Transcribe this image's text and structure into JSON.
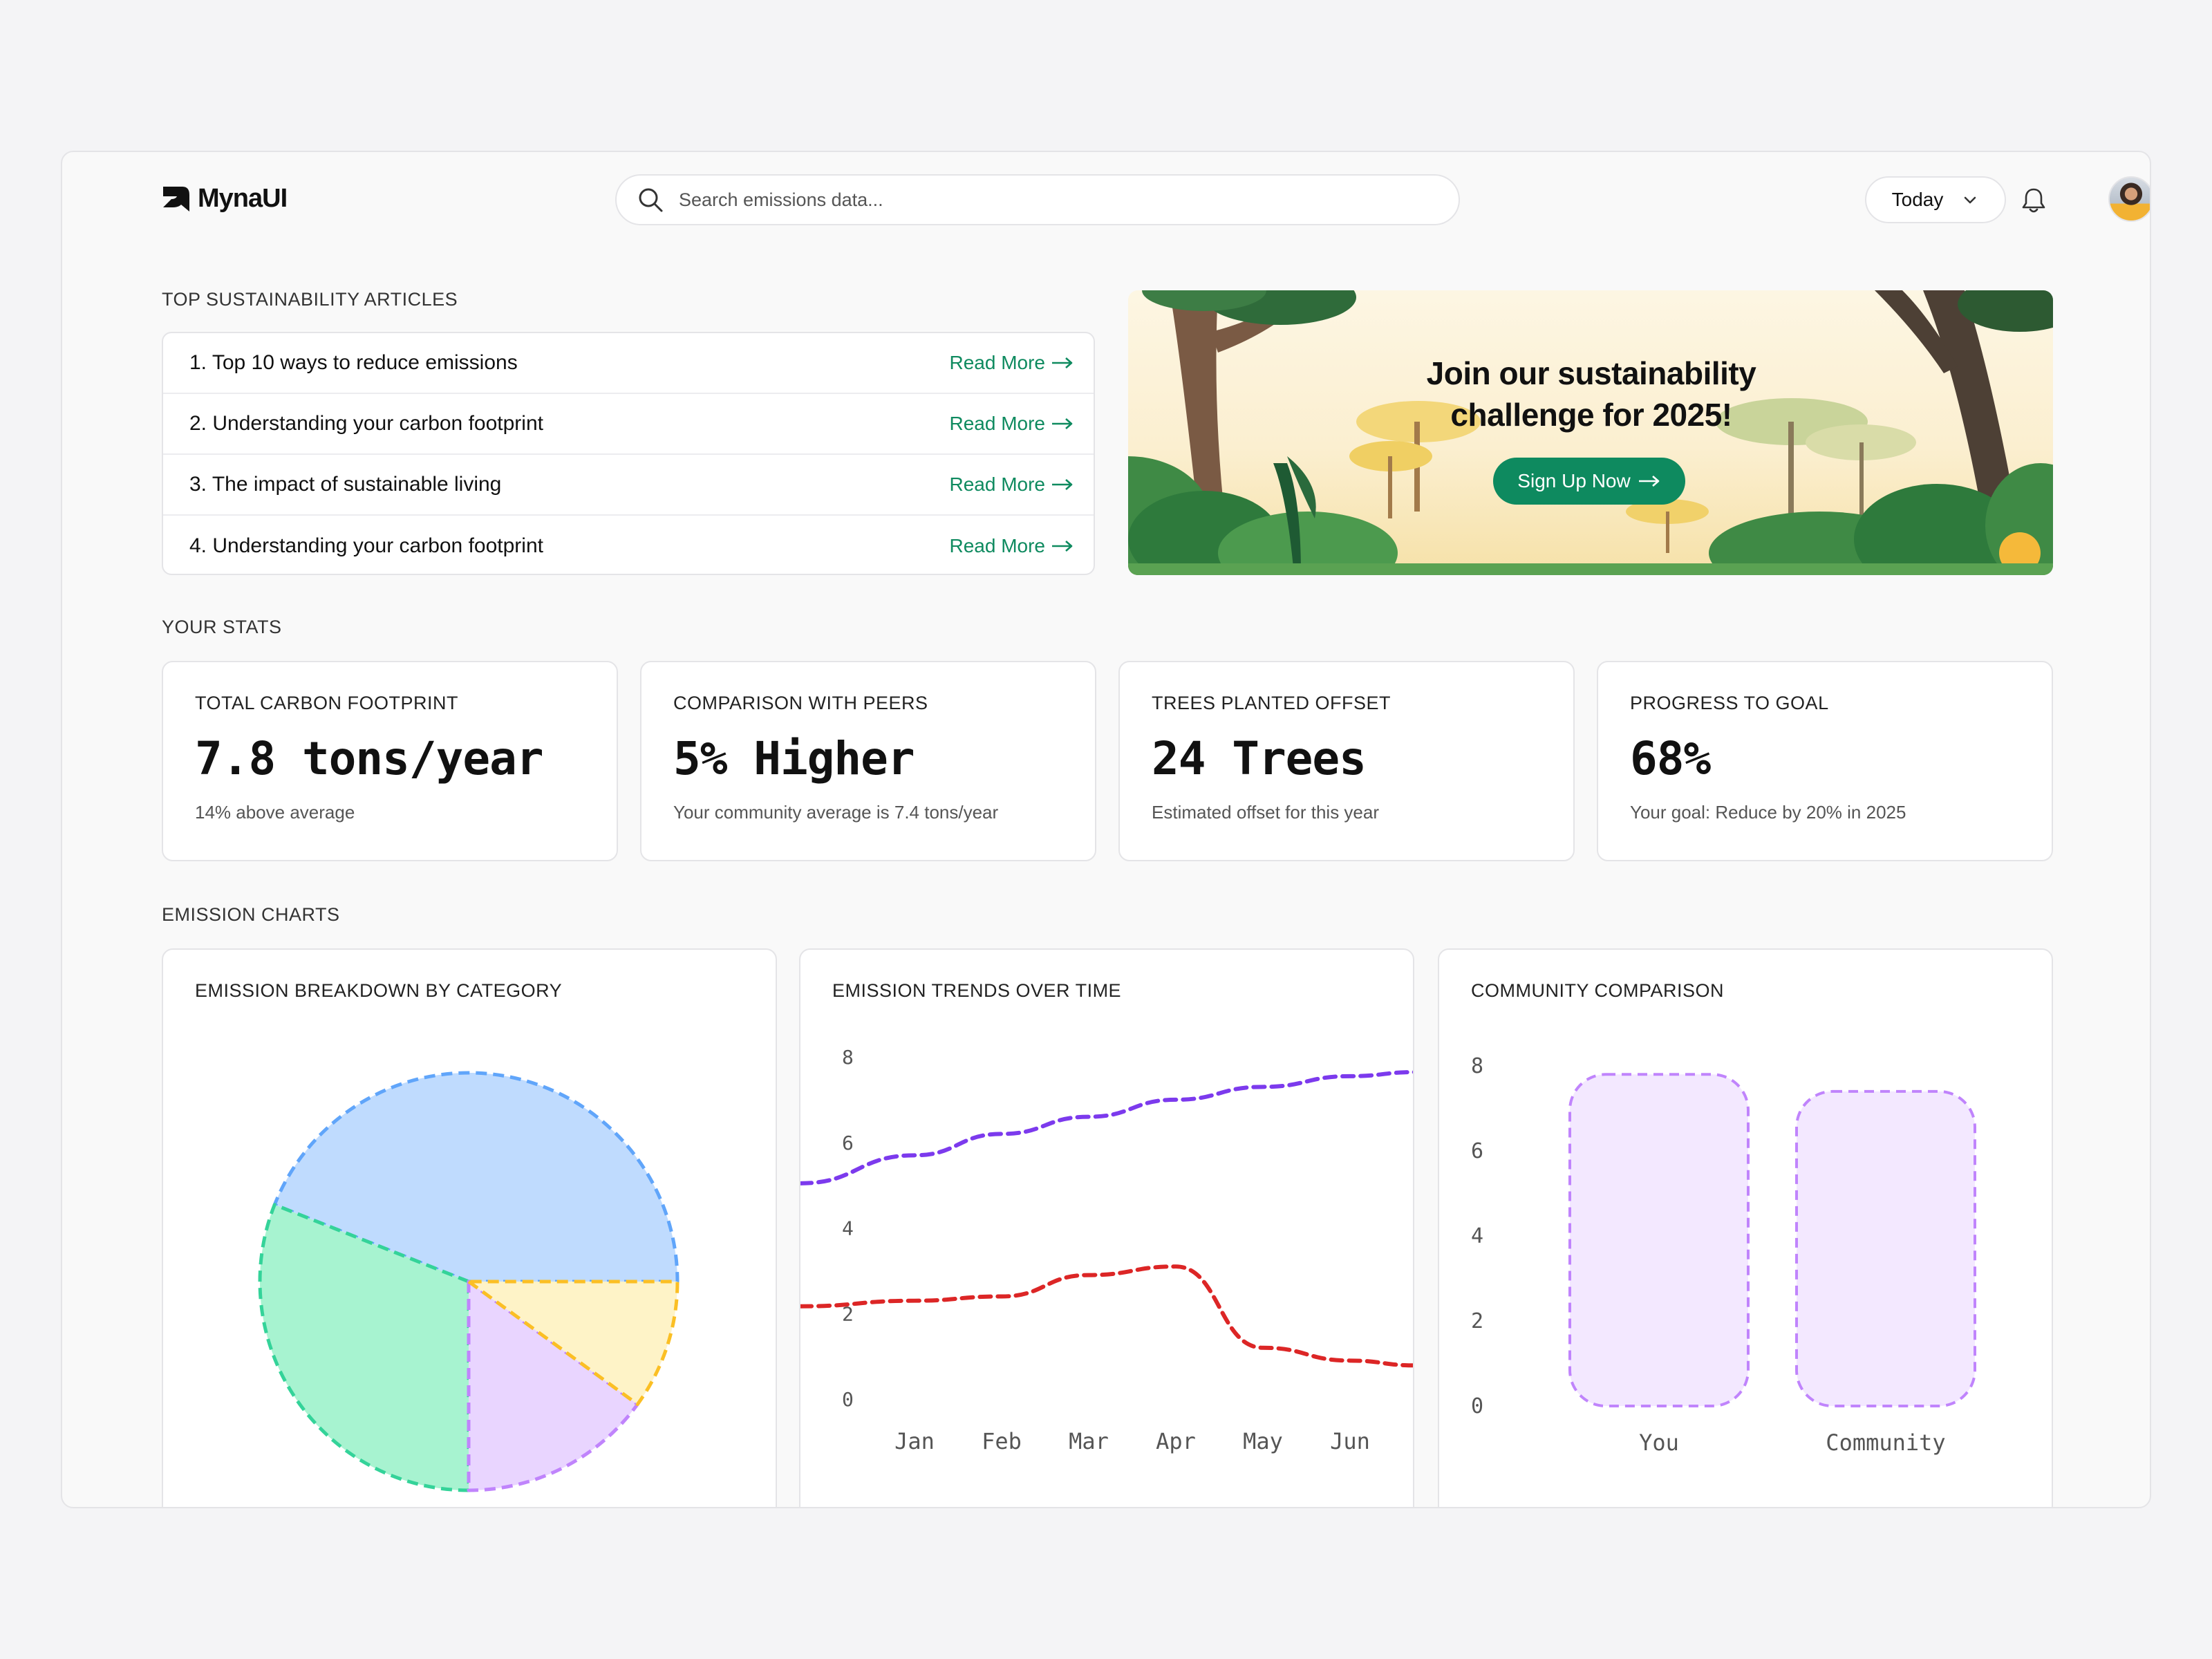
{
  "app": {
    "logo_text": "MynaUI"
  },
  "search": {
    "placeholder": "Search emissions data..."
  },
  "header": {
    "date_filter": "Today"
  },
  "articles": {
    "section_label": "TOP SUSTAINABILITY ARTICLES",
    "read_more_label": "Read More",
    "items": [
      {
        "title": "1. Top 10 ways to reduce emissions"
      },
      {
        "title": "2. Understanding your carbon footprint"
      },
      {
        "title": "3. The impact of sustainable living"
      },
      {
        "title": "4. Understanding your carbon footprint"
      }
    ]
  },
  "banner": {
    "line1": "Join our sustainability",
    "line2": "challenge for 2025!",
    "cta": "Sign Up Now"
  },
  "stats": {
    "section_label": "YOUR STATS",
    "cards": [
      {
        "label": "TOTAL CARBON FOOTPRINT",
        "value": "7.8 tons/year",
        "sub": "14% above average"
      },
      {
        "label": "COMPARISON WITH PEERS",
        "value": "5% Higher",
        "sub": "Your community average is 7.4 tons/year"
      },
      {
        "label": "TREES PLANTED OFFSET",
        "value": "24 Trees",
        "sub": "Estimated offset for this year"
      },
      {
        "label": "PROGRESS TO GOAL",
        "value": "68%",
        "sub": "Your goal: Reduce by 20% in 2025"
      }
    ]
  },
  "charts_section_label": "EMISSION CHARTS",
  "colors": {
    "accent": "#0e8a5f",
    "pie_blue": "#bfdbfe",
    "pie_blue_stroke": "#60a5fa",
    "pie_green": "#a7f3d0",
    "pie_green_stroke": "#34d399",
    "pie_purple": "#e9d5ff",
    "pie_purple_stroke": "#c084fc",
    "pie_yellow": "#fef3c7",
    "pie_yellow_stroke": "#fbbf24",
    "line_purple": "#7c3aed",
    "line_red": "#dc2626",
    "bar_fill": "#f3e8ff",
    "bar_stroke": "#c084fc"
  },
  "chart_data": [
    {
      "type": "pie",
      "title": "EMISSION BREAKDOWN BY CATEGORY",
      "slices": [
        {
          "value": 44
        },
        {
          "value": 31
        },
        {
          "value": 15
        },
        {
          "value": 10
        }
      ]
    },
    {
      "type": "line",
      "title": "EMISSION TRENDS OVER TIME",
      "x": [
        "Jan",
        "Feb",
        "Mar",
        "Apr",
        "May",
        "Jun"
      ],
      "yticks": [
        0,
        2,
        4,
        6,
        8
      ],
      "ylim": [
        0,
        8
      ],
      "series": [
        {
          "values": [
            5.7,
            6.2,
            6.6,
            7.0,
            7.3,
            7.55
          ]
        },
        {
          "values": [
            2.3,
            2.4,
            2.9,
            3.1,
            1.2,
            0.9
          ]
        }
      ]
    },
    {
      "type": "bar",
      "title": "COMMUNITY COMPARISON",
      "categories": [
        "You",
        "Community"
      ],
      "values": [
        7.8,
        7.4
      ],
      "yticks": [
        0,
        2,
        4,
        6,
        8
      ],
      "ylim": [
        0,
        8
      ]
    }
  ]
}
